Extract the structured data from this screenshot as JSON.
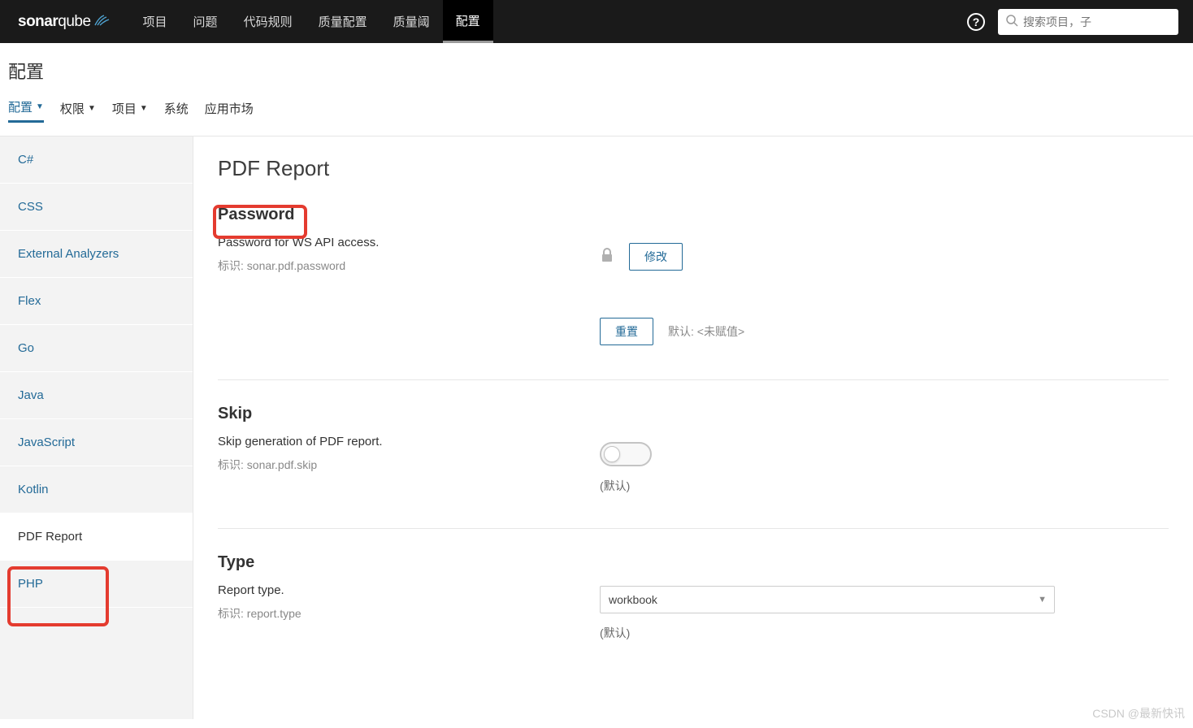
{
  "topnav": {
    "brand_prefix": "sonar",
    "brand_suffix": "qube",
    "items": [
      "项目",
      "问题",
      "代码规则",
      "质量配置",
      "质量阈",
      "配置"
    ],
    "active_index": 5,
    "search_placeholder": "搜索项目，子"
  },
  "page": {
    "title": "配置",
    "subtabs": [
      {
        "label": "配置",
        "caret": true
      },
      {
        "label": "权限",
        "caret": true
      },
      {
        "label": "项目",
        "caret": true
      },
      {
        "label": "系统",
        "caret": false
      },
      {
        "label": "应用市场",
        "caret": false
      }
    ],
    "active_subtab_index": 0
  },
  "sidebar": {
    "items": [
      "C#",
      "CSS",
      "External Analyzers",
      "Flex",
      "Go",
      "Java",
      "JavaScript",
      "Kotlin",
      "PDF Report",
      "PHP"
    ],
    "active_index": 8
  },
  "content": {
    "heading": "PDF Report",
    "settings": {
      "password": {
        "title": "Password",
        "description": "Password for WS API access.",
        "key_prefix": "标识: ",
        "key": "sonar.pdf.password",
        "modify_btn": "修改",
        "reset_btn": "重置",
        "default_label": "默认: ",
        "default_value": "<未赋值>"
      },
      "skip": {
        "title": "Skip",
        "description": "Skip generation of PDF report.",
        "key_prefix": "标识: ",
        "key": "sonar.pdf.skip",
        "default_text": "(默认)"
      },
      "type": {
        "title": "Type",
        "description": "Report type.",
        "key_prefix": "标识: ",
        "key": "report.type",
        "selected": "workbook",
        "default_text": "(默认)"
      }
    }
  },
  "watermark": "CSDN @最新快讯"
}
